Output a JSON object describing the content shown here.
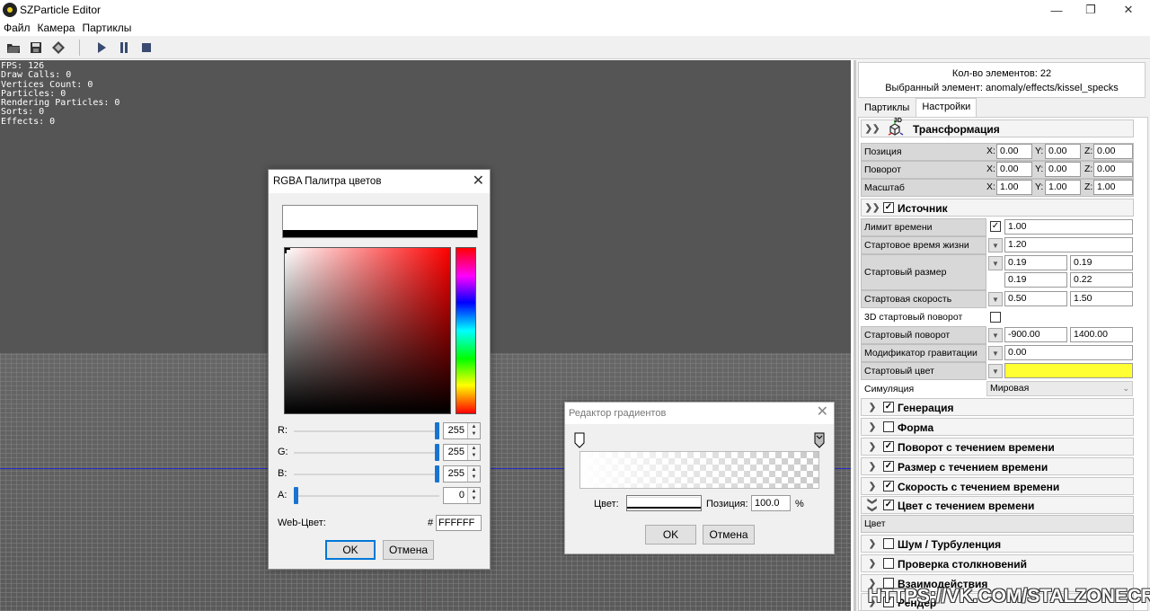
{
  "window": {
    "title": "SZParticle Editor"
  },
  "menu": [
    "Файл",
    "Камера",
    "Партиклы"
  ],
  "stats": [
    "FPS: 126",
    "Draw Calls: 0",
    "Vertices Count: 0",
    "Particles: 0",
    "Rendering Particles: 0",
    "Sorts: 0",
    "Effects: 0"
  ],
  "panel": {
    "count_label": "Кол-во элементов: 22",
    "selected_label": "Выбранный элемент: anomaly/effects/kissel_specks",
    "tabs": [
      "Партиклы",
      "Настройки"
    ],
    "transform": {
      "title": "Трансформация",
      "icon_text": "3D",
      "axis_labels": [
        "X:",
        "Y:",
        "Z:"
      ],
      "rows": [
        {
          "label": "Позиция",
          "x": "0.00",
          "y": "0.00",
          "z": "0.00"
        },
        {
          "label": "Поворот",
          "x": "0.00",
          "y": "0.00",
          "z": "0.00"
        },
        {
          "label": "Масштаб",
          "x": "1.00",
          "y": "1.00",
          "z": "1.00"
        }
      ]
    },
    "source": {
      "title": "Источник",
      "time_limit_label": "Лимит времени",
      "time_limit": "1.00",
      "start_lifetime_label": "Стартовое время жизни",
      "start_lifetime": "1.20",
      "start_size_label": "Стартовый размер",
      "start_size": [
        "0.19",
        "0.19",
        "0.19",
        "0.22"
      ],
      "start_speed_label": "Стартовая скорость",
      "start_speed": [
        "0.50",
        "1.50"
      ],
      "rot3d_label": "3D стартовый поворот",
      "start_rotation_label": "Стартовый поворот",
      "start_rotation": [
        "-900.00",
        "1400.00"
      ],
      "gravity_label": "Модификатор гравитации",
      "gravity": "0.00",
      "start_color_label": "Стартовый цвет",
      "start_color_hex": "#ffff33",
      "simulation_label": "Симуляция",
      "simulation": "Мировая"
    },
    "sections": [
      {
        "label": "Генерация",
        "checked": true
      },
      {
        "label": "Форма",
        "checked": false
      },
      {
        "label": "Поворот с течением времени",
        "checked": true
      },
      {
        "label": "Размер с течением времени",
        "checked": true
      },
      {
        "label": "Скорость с течением времени",
        "checked": true
      },
      {
        "label": "Цвет с течением времени",
        "checked": true,
        "expanded": true
      },
      {
        "label": "Шум / Турбуленция",
        "checked": false
      },
      {
        "label": "Проверка столкновений",
        "checked": false
      },
      {
        "label": "Взаимодействия",
        "checked": false
      },
      {
        "label": "Рендер",
        "checked": true
      }
    ],
    "color_row_label": "Цвет"
  },
  "color_dialog": {
    "title": "RGBA Палитра цветов",
    "channels": [
      {
        "label": "R:",
        "value": "255",
        "level": 1.0
      },
      {
        "label": "G:",
        "value": "255",
        "level": 1.0
      },
      {
        "label": "B:",
        "value": "255",
        "level": 1.0
      },
      {
        "label": "A:",
        "value": "0",
        "level": 0.0
      }
    ],
    "web_label": "Web-Цвет:",
    "hash": "#",
    "web_value": "FFFFFF",
    "ok": "OK",
    "cancel": "Отмена"
  },
  "gradient_dialog": {
    "title": "Редактор градиентов",
    "color_label": "Цвет:",
    "position_label": "Позиция:",
    "position_value": "100.0",
    "percent": "%",
    "ok": "OK",
    "cancel": "Отмена"
  },
  "watermark": "HTTPS://VK.COM/STALZONECRAFT"
}
